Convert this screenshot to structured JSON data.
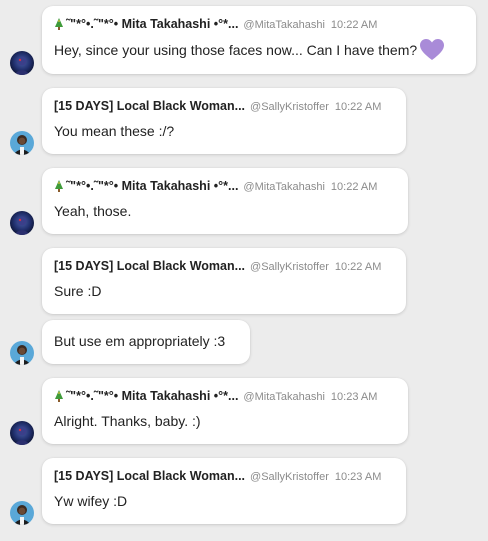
{
  "messages": [
    {
      "author": "Mita Takahashi",
      "name": "˜\"*°•.˜\"*°• Mita Takahashi •°*...",
      "handle": "@MitaTakahashi",
      "time": "10:22 AM",
      "text": "Hey, since your using those faces now... Can I have them?",
      "emoji": "tree-icon",
      "trailing_icon": "purple-heart-icon"
    },
    {
      "author": "Sally",
      "name": "[15 DAYS] Local Black Woman...",
      "handle": "@SallyKristoffer",
      "time": "10:22 AM",
      "text": "You mean these :/?"
    },
    {
      "author": "Mita Takahashi",
      "name": "˜\"*°•.˜\"*°• Mita Takahashi •°*...",
      "handle": "@MitaTakahashi",
      "time": "10:22 AM",
      "text": "Yeah, those.",
      "emoji": "tree-icon"
    },
    {
      "author": "Sally",
      "name": "[15 DAYS] Local Black Woman...",
      "handle": "@SallyKristoffer",
      "time": "10:22 AM",
      "text": "Sure :D"
    },
    {
      "author": "Sally",
      "text": "But use em appropriately :3"
    },
    {
      "author": "Mita Takahashi",
      "name": "˜\"*°•.˜\"*°• Mita Takahashi •°*...",
      "handle": "@MitaTakahashi",
      "time": "10:23 AM",
      "text": "Alright. Thanks, baby. :)",
      "emoji": "tree-icon"
    },
    {
      "author": "Sally",
      "name": "[15 DAYS] Local Black Woman...",
      "handle": "@SallyKristoffer",
      "time": "10:23 AM",
      "text": "Yw wifey :D"
    }
  ],
  "colors": {
    "background": "#ececec",
    "bubble": "#ffffff",
    "heart": "#a98bd8",
    "avatar_mita": "#1f2f66",
    "avatar_sally": "#5aa8d8"
  }
}
